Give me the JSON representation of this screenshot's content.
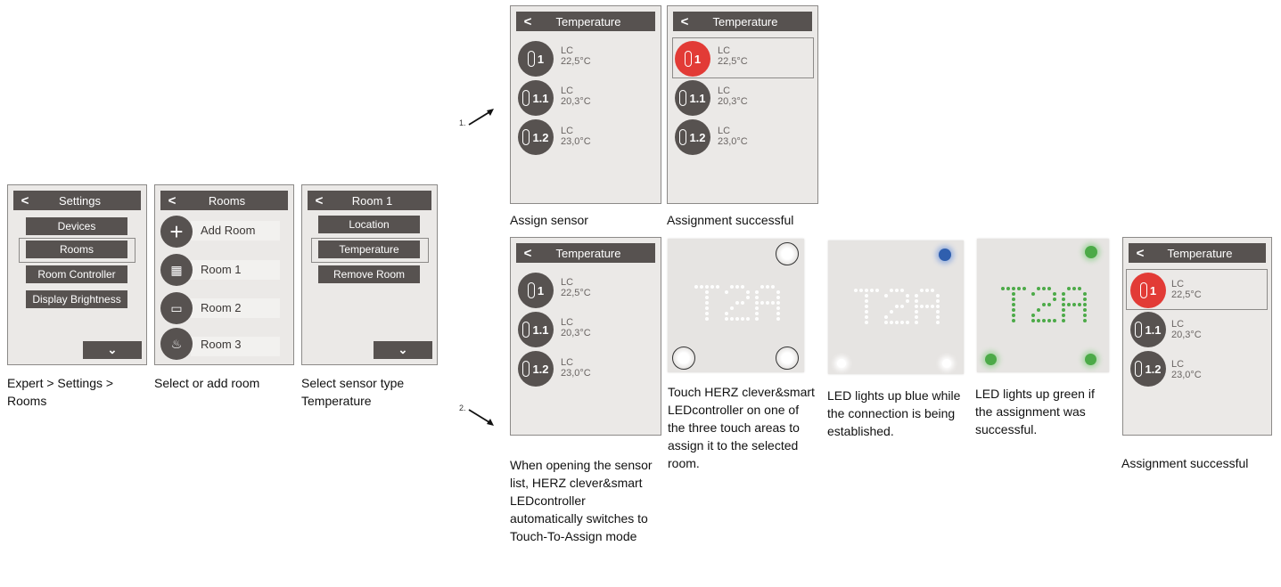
{
  "settings_panel": {
    "title": "Settings",
    "items": [
      "Devices",
      "Rooms",
      "Room Controller",
      "Display Brightness"
    ],
    "caption": "Expert > Settings > Rooms"
  },
  "rooms_panel": {
    "title": "Rooms",
    "items": [
      "Add Room",
      "Room 1",
      "Room 2",
      "Room 3"
    ],
    "caption": "Select or add room"
  },
  "room1_panel": {
    "title": "Room 1",
    "items": [
      "Location",
      "Temperature",
      "Remove Room"
    ],
    "caption": "Select sensor type Temperature"
  },
  "sensor_list": {
    "title": "Temperature",
    "sensors": [
      {
        "id": "1",
        "label": "LC",
        "value": "22,5°C"
      },
      {
        "id": "1.1",
        "label": "LC",
        "value": "20,3°C"
      },
      {
        "id": "1.2",
        "label": "LC",
        "value": "23,0°C"
      }
    ]
  },
  "steps": {
    "one": "1.",
    "two": "2."
  },
  "captions": {
    "assign_sensor": "Assign sensor",
    "assignment_successful_top": "Assignment successful",
    "open_list": "When opening the sensor list, HERZ clever&smart LEDcontroller automatically switches to Touch-To-Assign mode",
    "touch": "Touch HERZ clever&smart LEDcontroller on one of the three touch areas to assign it to the selected room.",
    "blue": "LED lights up blue while the connection is being established.",
    "green": "LED lights up green if the assignment was successful.",
    "assignment_successful_bottom": "Assignment successful"
  },
  "colors": {
    "header": "#575250",
    "selected": "#e23b36",
    "led_blue": "#2f5fae",
    "led_green": "#4caa48"
  }
}
